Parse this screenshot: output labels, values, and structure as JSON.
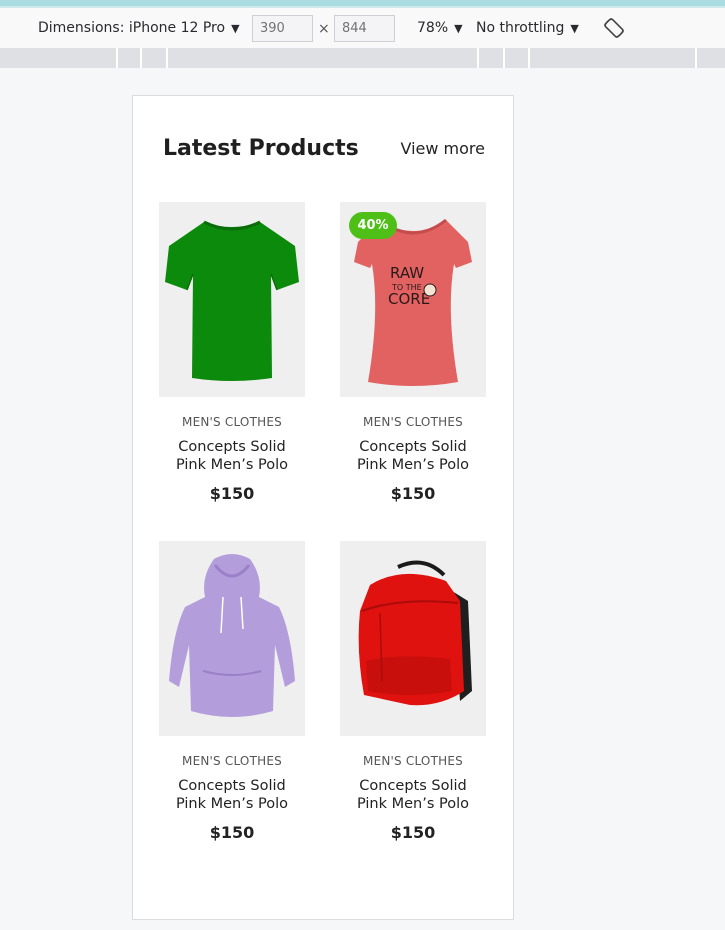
{
  "devtools": {
    "device_label": "Dimensions: iPhone 12 Pro",
    "width": "390",
    "height": "844",
    "times": "×",
    "zoom": "78%",
    "throttle": "No throttling"
  },
  "section": {
    "title": "Latest Products",
    "view_more": "View more"
  },
  "products": [
    {
      "category": "MEN'S CLOTHES",
      "title_line1": "Concepts Solid",
      "title_line2": "Pink Men’s Polo",
      "price": "$150",
      "image": "green-tshirt",
      "badge": ""
    },
    {
      "category": "MEN'S CLOTHES",
      "title_line1": "Concepts Solid",
      "title_line2": "Pink Men’s Polo",
      "price": "$150",
      "image": "pink-raw-to-the-core-tshirt",
      "badge": "40%",
      "print_line1": "RAW",
      "print_line2": "TO THE",
      "print_line3": "CORE"
    },
    {
      "category": "MEN'S CLOTHES",
      "title_line1": "Concepts Solid",
      "title_line2": "Pink Men’s Polo",
      "price": "$150",
      "image": "lavender-hoodie",
      "badge": ""
    },
    {
      "category": "MEN'S CLOTHES",
      "title_line1": "Concepts Solid",
      "title_line2": "Pink Men’s Polo",
      "price": "$150",
      "image": "red-backpack",
      "badge": ""
    }
  ],
  "colors": {
    "badge": "#4dbf16",
    "green_shirt": "#0c8a0c",
    "pink_shirt": "#e26262",
    "hoodie": "#b39ddb",
    "backpack": "#e0120f"
  }
}
